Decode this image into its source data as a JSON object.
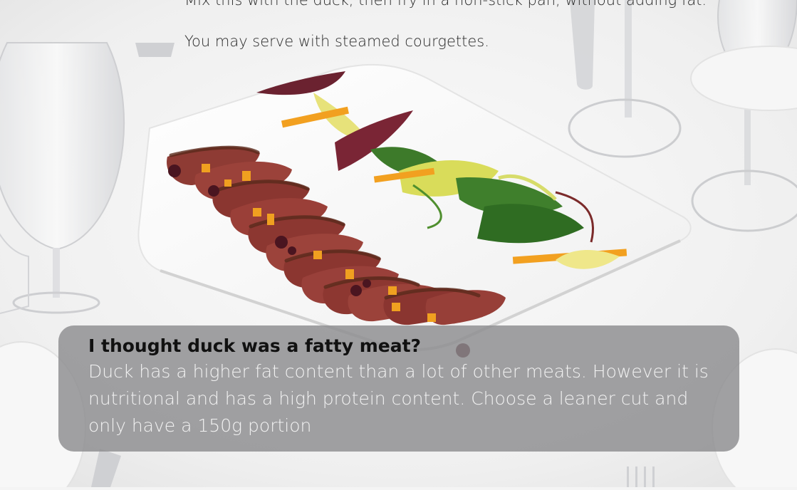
{
  "recipe": {
    "method_line": "Mix this with the duck, then fry in a non-stick pan, without adding fat.",
    "serving_tip": "You may serve with steamed courgettes."
  },
  "callout": {
    "question": "I thought duck was a fatty meat?",
    "answer": "Duck has a higher fat content than a lot of other meats. However it is nutritional and has a high protein content. Choose a leaner cut and only have a 150g portion"
  },
  "image": {
    "subject": "sliced-duck-breast-with-salad-on-rectangular-plate"
  }
}
